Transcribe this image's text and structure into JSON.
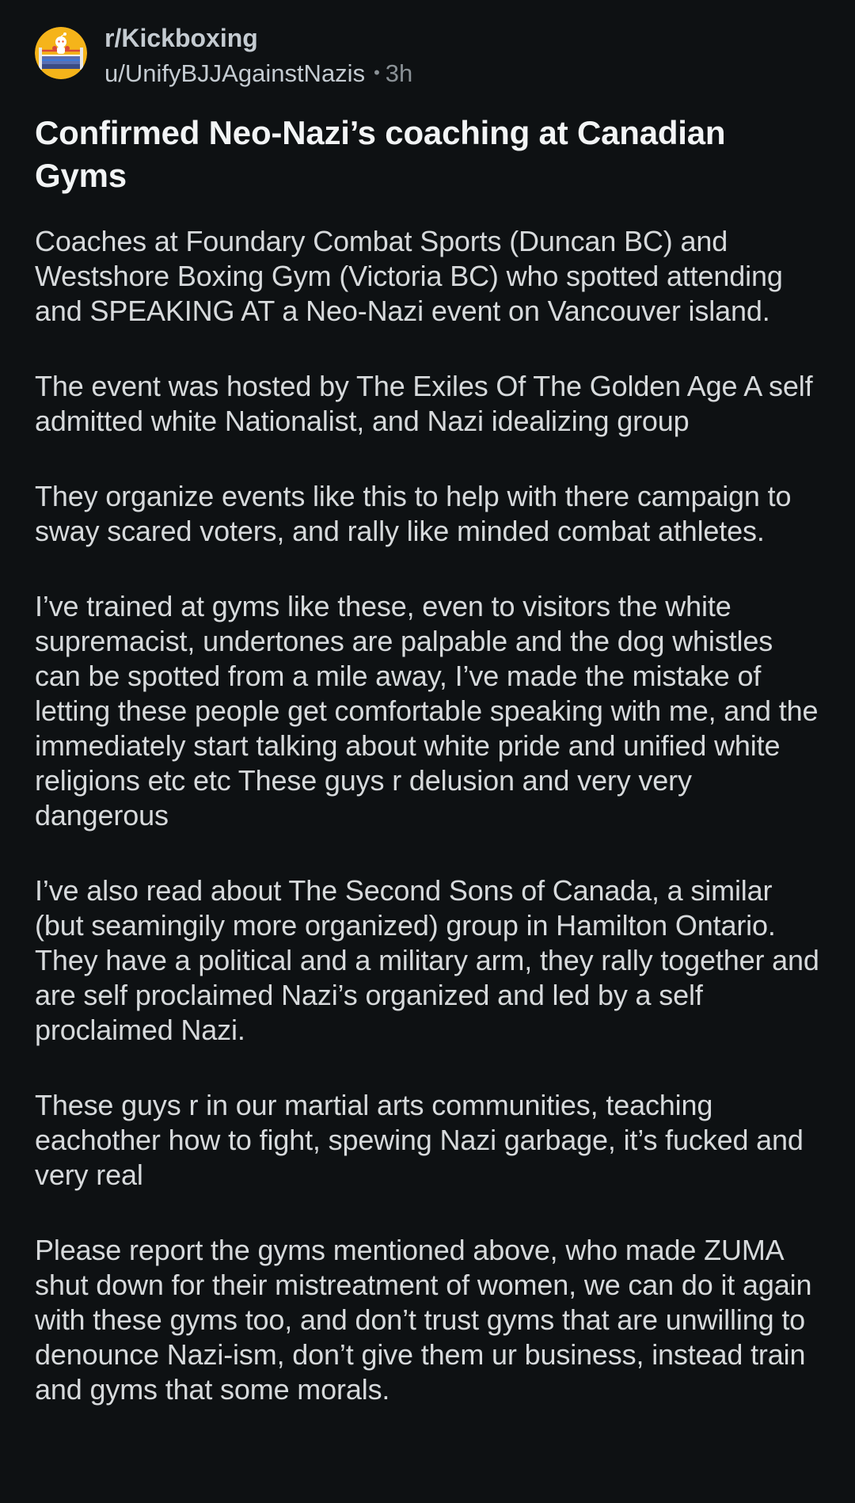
{
  "post": {
    "subreddit": "r/Kickboxing",
    "author": "u/UnifyBJJAgainstNazis",
    "separator": "•",
    "time_ago": "3h",
    "title": "Confirmed Neo-Nazi’s coaching at Canadian Gyms",
    "paragraphs": [
      "Coaches at Foundary Combat Sports (Duncan BC) and Westshore Boxing Gym (Victoria BC) who spotted attending and SPEAKING AT a Neo-Nazi event on Vancouver island.",
      "The event was hosted by The Exiles Of The Golden Age A self admitted white Nationalist, and Nazi idealizing group",
      "They organize events like this to help with there campaign to sway scared voters, and rally like minded combat athletes.",
      "I’ve trained at gyms like these, even to visitors the white supremacist, undertones are palpable and the dog whistles can be spotted from a mile away, I’ve made the mistake of letting these people get comfortable speaking with me, and the immediately start talking about white pride and unified white religions etc etc These guys r delusion and very very dangerous",
      "I’ve also read about The Second Sons of Canada, a similar (but seamingily more organized) group in Hamilton Ontario. They have a political and a military arm, they rally together and are self proclaimed Nazi’s organized and led by a self proclaimed Nazi.",
      "These guys r in our martial arts communities, teaching eachother how to fight, spewing Nazi garbage, it’s fucked and very real",
      "Please report the gyms mentioned above, who made ZUMA shut down for their mistreatment of women, we can do it again with these gyms too, and don’t trust gyms that are unwilling to denounce Nazi-ism, don’t give them ur business, instead train and gyms that some morals."
    ]
  },
  "icons": {
    "avatar": "subreddit-avatar-boxing-ring-icon"
  },
  "colors": {
    "background": "#0e1113",
    "title": "#f2f4f5",
    "body_text": "#d7dadc",
    "meta_text": "#8a9196",
    "avatar_ring": "#f5b41a"
  }
}
